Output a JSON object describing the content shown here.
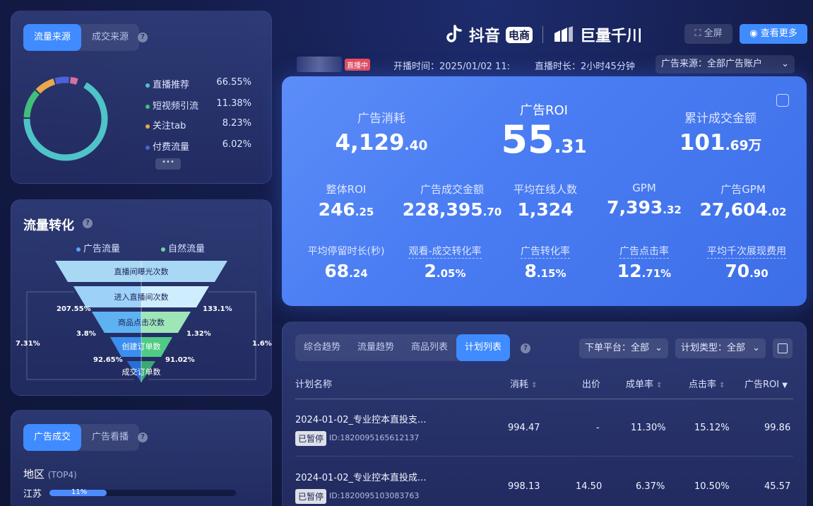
{
  "source_panel": {
    "tabs": [
      "流量来源",
      "成交来源"
    ],
    "legend": [
      {
        "label": "直播推荐",
        "value": "66.55%",
        "color": "#4fc3c8"
      },
      {
        "label": "短视频引流",
        "value": "11.38%",
        "color": "#3fbf78"
      },
      {
        "label": "关注tab",
        "value": "8.23%",
        "color": "#e9a84a"
      },
      {
        "label": "付费流量",
        "value": "6.02%",
        "color": "#4a63d8"
      }
    ],
    "more": "•••"
  },
  "conversion": {
    "title": "流量转化",
    "legend_ad": "广告流量",
    "legend_natural": "自然流量",
    "stages": [
      "直播间曝光次数",
      "进入直播间次数",
      "商品点击次数",
      "创建订单数",
      "成交订单数"
    ],
    "pcts": {
      "left_1": "207.55%",
      "right_1": "133.1%",
      "left_2": "3.8%",
      "right_2": "1.32%",
      "left_3": "92.65%",
      "right_3": "91.02%",
      "outer_left": "7.31%",
      "outer_right": "1.6%"
    }
  },
  "ad_panel": {
    "tabs": [
      "广告成交",
      "广告看播"
    ],
    "region_title": "地区",
    "region_sub": "(TOP4)",
    "region_rows": [
      {
        "name": "江苏",
        "pct": "11%",
        "value": 0.11
      }
    ]
  },
  "header": {
    "brand1": "抖音",
    "brand1_badge": "电商",
    "brand2": "巨量千川",
    "fullscreen": "全屏",
    "view_more": "查看更多",
    "live_badge": "直播中",
    "start_time": "开播时间：2025/01/02 11:",
    "duration": "直播时长：2小时45分钟",
    "ad_source": "广告来源：全部广告账户"
  },
  "metrics": {
    "ad_spend_label": "广告消耗",
    "ad_spend_int": "4,129",
    "ad_spend_dec": ".40",
    "roi_label": "广告ROI",
    "roi_int": "55",
    "roi_dec": ".31",
    "gmv_label": "累计成交金额",
    "gmv_int": "101",
    "gmv_dec": ".69万",
    "row1": [
      {
        "label": "整体ROI",
        "int": "246",
        "dec": ".25"
      },
      {
        "label": "广告成交金额",
        "int": "228,395",
        "dec": ".70"
      },
      {
        "label": "平均在线人数",
        "int": "1,324",
        "dec": ""
      },
      {
        "label": "GPM",
        "int": "7,393",
        "dec": ".32"
      },
      {
        "label": "广告GPM",
        "int": "27,604",
        "dec": ".02"
      }
    ],
    "row2": [
      {
        "label": "平均停留时长(秒)",
        "int": "68",
        "dec": ".24"
      },
      {
        "label": "观看-成交转化率",
        "int": "2",
        "dec": ".05%"
      },
      {
        "label": "广告转化率",
        "int": "8",
        "dec": ".15%"
      },
      {
        "label": "广告点击率",
        "int": "12",
        "dec": ".71%"
      },
      {
        "label": "平均千次展现费用",
        "int": "70",
        "dec": ".90"
      }
    ]
  },
  "table": {
    "tabs": [
      "综合趋势",
      "流量趋势",
      "商品列表",
      "计划列表"
    ],
    "platform_filter": "下单平台：全部",
    "type_filter": "计划类型：全部",
    "headers": [
      "计划名称",
      "消耗",
      "出价",
      "成单率",
      "点击率",
      "广告ROI"
    ],
    "rows": [
      {
        "name": "2024-01-02_专业控本直投支...",
        "status": "已暂停",
        "id": "ID:1820095165612137",
        "spend": "994.47",
        "bid": "-",
        "order_rate": "11.30%",
        "ctr": "15.12%",
        "roi": "99.86"
      },
      {
        "name": "2024-01-02_专业控本直投成...",
        "status": "已暂停",
        "id": "ID:1820095103083763",
        "spend": "998.13",
        "bid": "14.50",
        "order_rate": "6.37%",
        "ctr": "10.50%",
        "roi": "45.57"
      }
    ]
  }
}
